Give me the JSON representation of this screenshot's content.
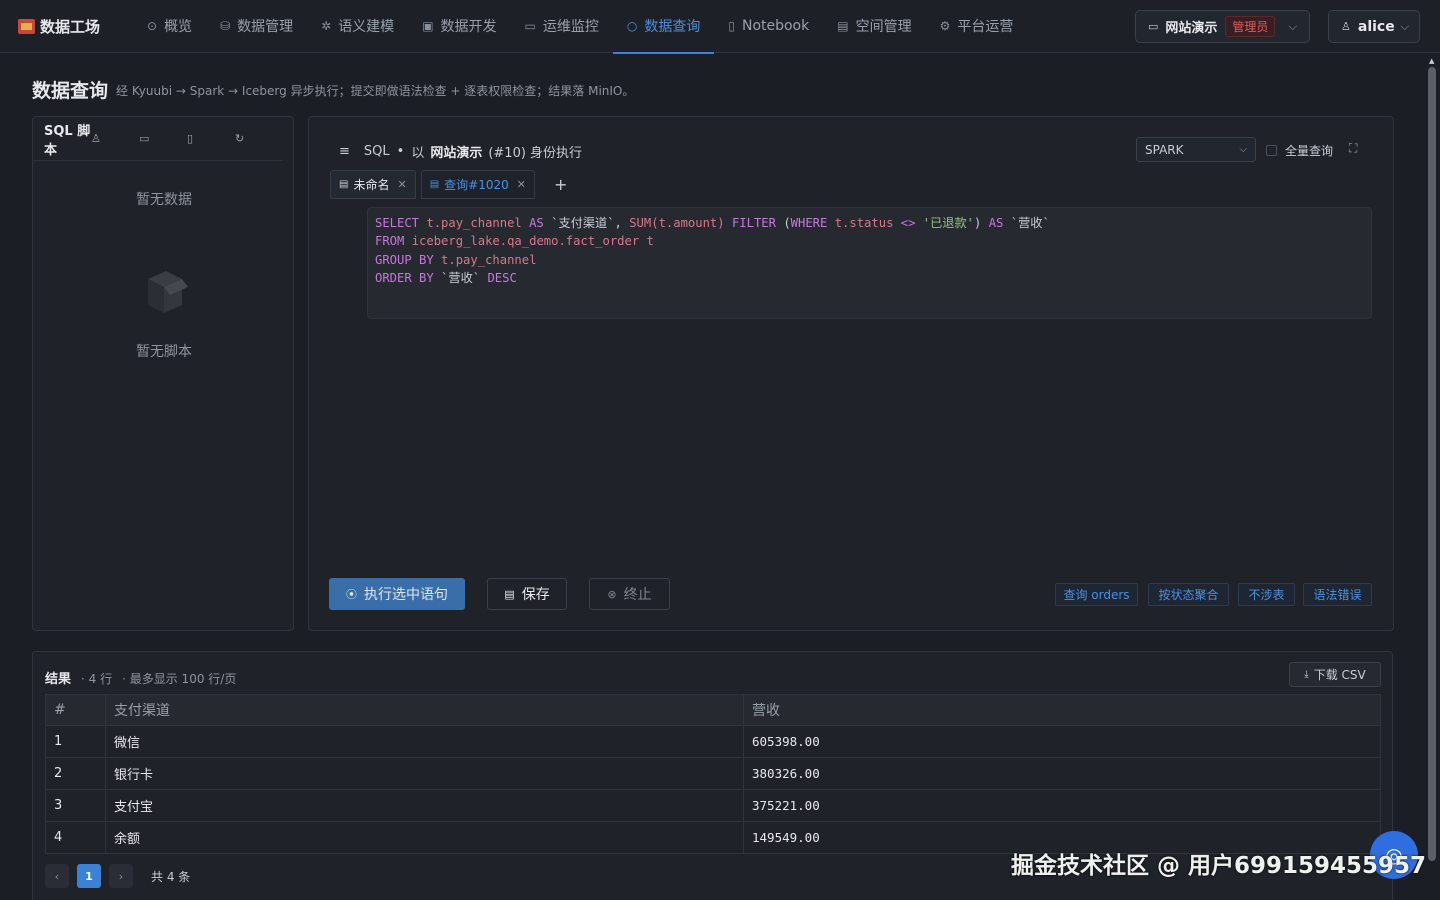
{
  "app": {
    "name": "数据工场"
  },
  "nav": [
    {
      "label": "概览",
      "icon": "⊙"
    },
    {
      "label": "数据管理",
      "icon": "⛁"
    },
    {
      "label": "语义建模",
      "icon": "✲"
    },
    {
      "label": "数据开发",
      "icon": "▣"
    },
    {
      "label": "运维监控",
      "icon": "▭"
    },
    {
      "label": "数据查询",
      "icon": "○"
    },
    {
      "label": "Notebook",
      "icon": "▯"
    },
    {
      "label": "空间管理",
      "icon": "▤"
    },
    {
      "label": "平台运营",
      "icon": "⚙"
    }
  ],
  "header": {
    "workspace": "网站演示",
    "role": "管理员",
    "user": "alice"
  },
  "page": {
    "title": "数据查询",
    "description": "经 Kyuubi → Spark → Iceberg 异步执行；提交即做语法检查 + 逐表权限检查；结果落 MinIO。"
  },
  "scripts": {
    "title": "SQL 脚本",
    "empty_data": "暂无数据",
    "empty_scripts": "暂无脚本"
  },
  "editor": {
    "mode": "SQL",
    "exec_as_prefix": "以",
    "exec_as_ws": "网站演示",
    "exec_as_suffix": "(#10) 身份执行",
    "engine": "SPARK",
    "full_query_label": "全量查询",
    "tabs": [
      {
        "label": "未命名"
      },
      {
        "label": "查询#1020"
      }
    ],
    "run_label": "执行选中语句",
    "save_label": "保存",
    "stop_label": "终止",
    "quick_actions": [
      "查询 orders",
      "按状态聚合",
      "不涉表",
      "语法错误"
    ],
    "sql": {
      "l1": [
        "SELECT",
        " t.pay_channel ",
        "AS",
        " `支付渠道`, ",
        "SUM(t.amount)",
        " ",
        "FILTER",
        " (",
        "WHERE",
        " ",
        "t.status",
        " <> ",
        "'已退款'",
        ") ",
        "AS",
        " `营收`"
      ],
      "l2": [
        "FROM",
        " ",
        "iceberg_lake.qa_demo.fact_order t"
      ],
      "l3": [
        "GROUP BY",
        " ",
        "t.pay_channel"
      ],
      "l4": [
        "ORDER BY",
        " `营收` ",
        "DESC"
      ]
    }
  },
  "results": {
    "title": "结果",
    "rows_meta": "· 4 行",
    "page_meta": "· 最多显示 100 行/页",
    "download_label": "下载 CSV",
    "columns": [
      "#",
      "支付渠道",
      "营收"
    ],
    "rows": [
      [
        "1",
        "微信",
        "605398.00"
      ],
      [
        "2",
        "银行卡",
        "380326.00"
      ],
      [
        "3",
        "支付宝",
        "375221.00"
      ],
      [
        "4",
        "余额",
        "149549.00"
      ]
    ],
    "current_page": "1",
    "total_label": "共 4 条"
  },
  "watermark": "掘金技术社区 @ 用户6991594559​57"
}
